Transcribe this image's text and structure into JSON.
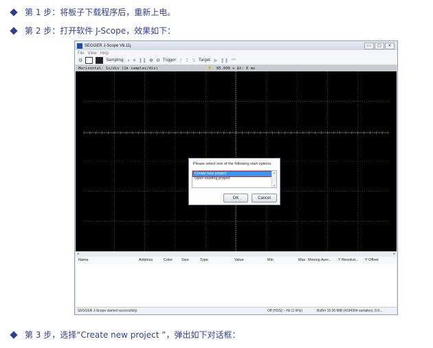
{
  "steps": [
    {
      "text": "第 1 步：将板子下载程序后，重新上电。"
    },
    {
      "text": "第 2 步：打开软件 J-Scope，效果如下："
    },
    {
      "text": "第 3 步，选择“Create new project ”，弹出如下对话框："
    }
  ],
  "window": {
    "title": "SEGGER J-Scope V6.11j",
    "controls": [
      "▭",
      "▢",
      "✕"
    ],
    "menu": [
      "File",
      "View",
      "Help"
    ],
    "toolbar": {
      "sampling_label": "Sampling:",
      "trigger_label": "Trigger:",
      "target_label": "Target:"
    },
    "horizontal_label": "Horizontal: 1s/div (1k samples/div)",
    "time_readout": "05.000 s   Δt: 0 ms",
    "columns": [
      "Name",
      "Address",
      "Color",
      "Size",
      "Type",
      "Value",
      "Min",
      "Max",
      "Moving Aver...",
      "Y Resoluti...",
      "Y Offset"
    ],
    "status": {
      "message": "SEGGER J-Scope started successfully.",
      "mode": "Off (HSS): - Hz (1 kHz)",
      "buffer": "Buffer 16.00 MiB (4194304 samples), 0.0..."
    }
  },
  "dialog": {
    "prompt": "Please select one of the following start options:",
    "options": [
      "Create new project",
      "Open existing project"
    ],
    "ok_label": "OK",
    "cancel_label": "Cancel"
  },
  "colors": {
    "accent_text": "#2f3f8f",
    "scope_bg": "#000000",
    "trace": "#e6a300",
    "grid": "#5a5a5a",
    "selection": "#3399ff",
    "highlight_box": "#e02020"
  }
}
